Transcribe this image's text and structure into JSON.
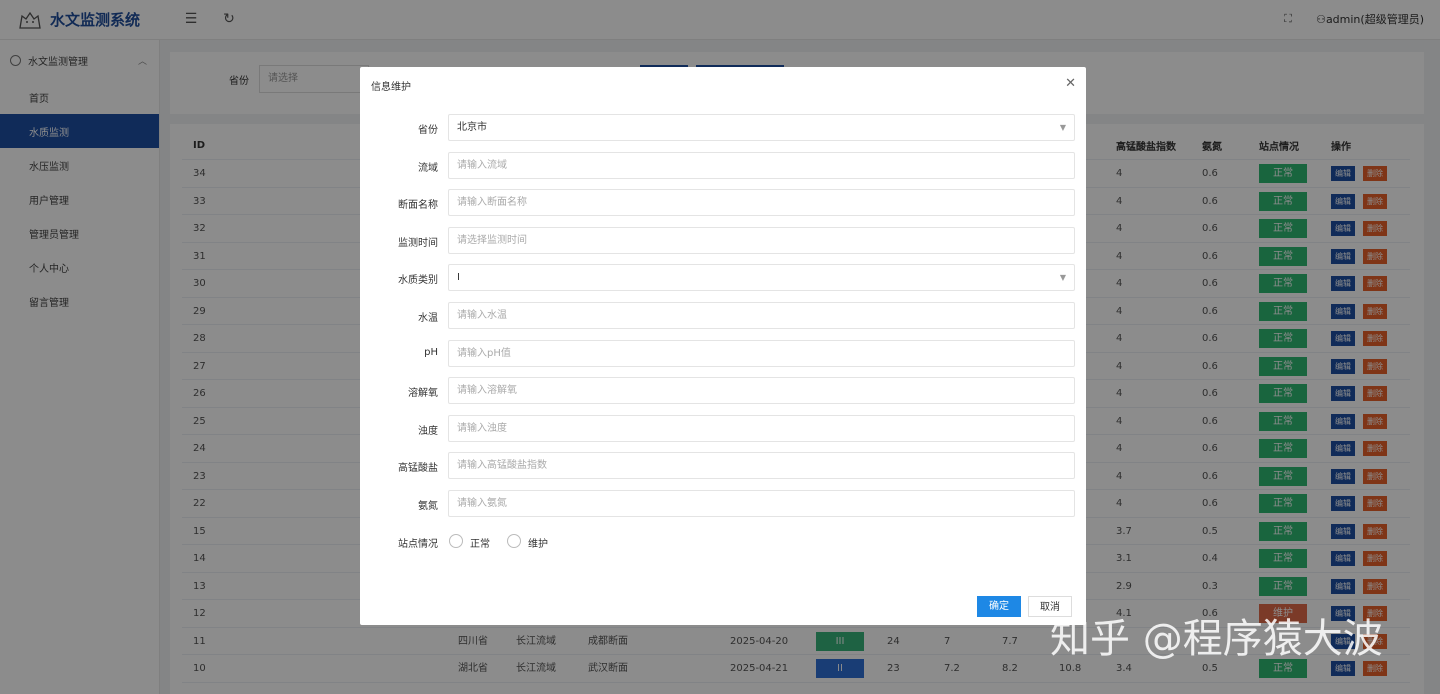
{
  "app": {
    "title": "水文监测系统",
    "user": "admin(超级管理员)"
  },
  "sidebar": {
    "group": "水文监测管理",
    "items": [
      {
        "label": "首页",
        "active": false
      },
      {
        "label": "水质监测",
        "active": true
      },
      {
        "label": "水压监测",
        "active": false
      },
      {
        "label": "用户管理",
        "active": false
      },
      {
        "label": "管理员管理",
        "active": false
      },
      {
        "label": "个人中心",
        "active": false
      },
      {
        "label": "留言管理",
        "active": false
      }
    ]
  },
  "search": {
    "province_label": "省份",
    "province_placeholder": "请选择"
  },
  "table": {
    "headers": {
      "id": "ID",
      "kmno4": "高锰酸盐指数",
      "nh3": "氨氮",
      "status": "站点情况",
      "ops": "操作"
    },
    "edit_label": "编辑",
    "delete_label": "删除",
    "rows": [
      {
        "id": "34",
        "kmno4": "4",
        "nh3": "0.6",
        "status": "正常"
      },
      {
        "id": "33",
        "kmno4": "4",
        "nh3": "0.6",
        "status": "正常"
      },
      {
        "id": "32",
        "kmno4": "4",
        "nh3": "0.6",
        "status": "正常"
      },
      {
        "id": "31",
        "kmno4": "4",
        "nh3": "0.6",
        "status": "正常"
      },
      {
        "id": "30",
        "kmno4": "4",
        "nh3": "0.6",
        "status": "正常"
      },
      {
        "id": "29",
        "kmno4": "4",
        "nh3": "0.6",
        "status": "正常"
      },
      {
        "id": "28",
        "kmno4": "4",
        "nh3": "0.6",
        "status": "正常"
      },
      {
        "id": "27",
        "kmno4": "4",
        "nh3": "0.6",
        "status": "正常"
      },
      {
        "id": "26",
        "kmno4": "4",
        "nh3": "0.6",
        "status": "正常"
      },
      {
        "id": "25",
        "kmno4": "4",
        "nh3": "0.6",
        "status": "正常"
      },
      {
        "id": "24",
        "kmno4": "4",
        "nh3": "0.6",
        "status": "正常"
      },
      {
        "id": "23",
        "kmno4": "4",
        "nh3": "0.6",
        "status": "正常"
      },
      {
        "id": "22",
        "kmno4": "4",
        "nh3": "0.6",
        "status": "正常"
      },
      {
        "id": "15",
        "kmno4": "3.7",
        "nh3": "0.5",
        "status": "正常"
      },
      {
        "id": "14",
        "kmno4": "3.1",
        "nh3": "0.4",
        "status": "正常"
      },
      {
        "id": "13",
        "kmno4": "2.9",
        "nh3": "0.3",
        "status": "正常"
      },
      {
        "id": "12",
        "kmno4": "4.1",
        "nh3": "0.6",
        "status": "维护"
      }
    ],
    "full_rows": [
      {
        "id": "11",
        "province": "四川省",
        "basin": "长江流域",
        "section": "成都断面",
        "date": "2025-04-20",
        "grade": "III",
        "c1": "24",
        "c2": "7",
        "c3": "7.7",
        "c4": "",
        "kmno4": "",
        "nh3": "",
        "status": ""
      },
      {
        "id": "10",
        "province": "湖北省",
        "basin": "长江流域",
        "section": "武汉断面",
        "date": "2025-04-21",
        "grade": "II",
        "c1": "23",
        "c2": "7.2",
        "c3": "8.2",
        "c4": "10.8",
        "kmno4": "3.4",
        "nh3": "0.5",
        "status": "正常"
      }
    ]
  },
  "dialog": {
    "title": "信息维护",
    "fields": [
      {
        "label": "省份",
        "value": "北京市",
        "placeholder": "",
        "select": true
      },
      {
        "label": "流域",
        "value": "",
        "placeholder": "请输入流域",
        "select": false
      },
      {
        "label": "断面名称",
        "value": "",
        "placeholder": "请输入断面名称",
        "select": false
      },
      {
        "label": "监测时间",
        "value": "",
        "placeholder": "请选择监测时间",
        "select": false
      },
      {
        "label": "水质类别",
        "value": "I",
        "placeholder": "",
        "select": true
      },
      {
        "label": "水温",
        "value": "",
        "placeholder": "请输入水温",
        "select": false
      },
      {
        "label": "pH",
        "value": "",
        "placeholder": "请输入pH值",
        "select": false
      },
      {
        "label": "溶解氧",
        "value": "",
        "placeholder": "请输入溶解氧",
        "select": false
      },
      {
        "label": "浊度",
        "value": "",
        "placeholder": "请输入浊度",
        "select": false
      },
      {
        "label": "高锰酸盐",
        "value": "",
        "placeholder": "请输入高锰酸盐指数",
        "select": false
      },
      {
        "label": "氨氮",
        "value": "",
        "placeholder": "请输入氨氮",
        "select": false
      }
    ],
    "station_label": "站点情况",
    "radio_normal": "正常",
    "radio_maintain": "维护",
    "confirm": "确定",
    "cancel": "取消"
  },
  "watermark": "知乎 @程序猿大波"
}
